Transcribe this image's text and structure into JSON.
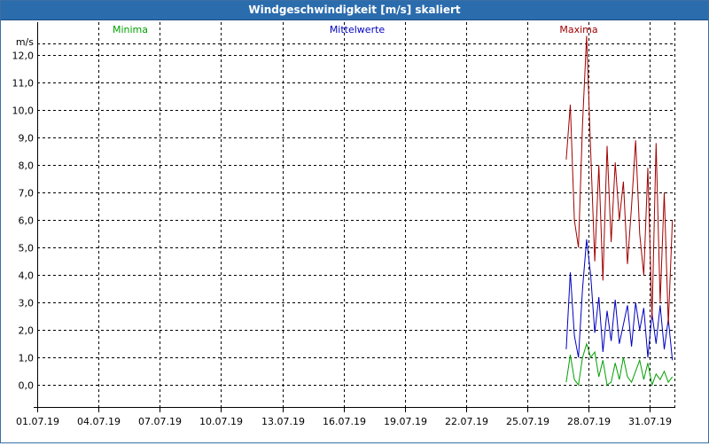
{
  "window": {
    "title": "Windgeschwindigkeit [m/s] skaliert"
  },
  "colors": {
    "minima": "#00a000",
    "mittelwerte": "#0000c0",
    "maxima": "#a00000"
  },
  "chart_data": {
    "type": "line",
    "title": "Windgeschwindigkeit [m/s] skaliert",
    "ylabel": "m/s",
    "xlabel": "",
    "ylim": [
      -0.8,
      13.2
    ],
    "yticks": [
      0.0,
      1.0,
      2.0,
      3.0,
      4.0,
      5.0,
      6.0,
      7.0,
      8.0,
      9.0,
      10.0,
      11.0,
      12.0
    ],
    "ytick_labels": [
      "0,0",
      "1,0",
      "2,0",
      "3,0",
      "4,0",
      "5,0",
      "6,0",
      "7,0",
      "8,0",
      "9,0",
      "10,0",
      "11,0",
      "12,0"
    ],
    "xlim": [
      0,
      31.2
    ],
    "xticks": [
      0,
      3,
      6,
      9,
      12,
      15,
      18,
      21,
      24,
      27,
      30
    ],
    "xtick_labels": [
      "01.07.19",
      "04.07.19",
      "07.07.19",
      "10.07.19",
      "13.07.19",
      "16.07.19",
      "19.07.19",
      "22.07.19",
      "25.07.19",
      "28.07.19",
      "31.07.19"
    ],
    "x_unit": "days since 01.07.19",
    "grid": true,
    "series": [
      {
        "name": "Minima",
        "color": "#00a000",
        "x": [
          25.9,
          26.1,
          26.3,
          26.5,
          26.7,
          26.9,
          27.1,
          27.3,
          27.5,
          27.7,
          27.9,
          28.1,
          28.3,
          28.5,
          28.7,
          28.9,
          29.1,
          29.3,
          29.5,
          29.7,
          29.9,
          30.1,
          30.3,
          30.5,
          30.7,
          30.9,
          31.1
        ],
        "values": [
          0.1,
          1.1,
          0.2,
          0.0,
          1.0,
          1.5,
          1.0,
          1.2,
          0.3,
          0.9,
          0.0,
          0.1,
          0.8,
          0.2,
          1.0,
          0.3,
          0.1,
          0.5,
          0.9,
          0.2,
          0.8,
          0.0,
          0.4,
          0.2,
          0.5,
          0.1,
          0.3
        ]
      },
      {
        "name": "Mittelwerte",
        "color": "#0000c0",
        "x": [
          25.9,
          26.1,
          26.3,
          26.5,
          26.7,
          26.9,
          27.1,
          27.3,
          27.5,
          27.7,
          27.9,
          28.1,
          28.3,
          28.5,
          28.7,
          28.9,
          29.1,
          29.3,
          29.5,
          29.7,
          29.9,
          30.1,
          30.3,
          30.5,
          30.7,
          30.9,
          31.1
        ],
        "values": [
          1.3,
          4.1,
          1.8,
          1.0,
          3.5,
          5.3,
          4.0,
          1.9,
          3.2,
          1.2,
          2.7,
          1.6,
          3.1,
          1.5,
          2.2,
          2.9,
          1.4,
          3.0,
          2.0,
          2.8,
          1.0,
          2.6,
          1.5,
          2.9,
          1.3,
          2.4,
          0.9
        ]
      },
      {
        "name": "Maxima",
        "color": "#a00000",
        "x": [
          25.9,
          26.1,
          26.3,
          26.5,
          26.7,
          26.9,
          27.1,
          27.3,
          27.5,
          27.7,
          27.9,
          28.1,
          28.3,
          28.5,
          28.7,
          28.9,
          29.1,
          29.3,
          29.5,
          29.7,
          29.9,
          30.1,
          30.3,
          30.5,
          30.7,
          30.9,
          31.1
        ],
        "values": [
          8.2,
          10.2,
          6.0,
          5.0,
          9.5,
          12.7,
          8.5,
          4.5,
          8.0,
          3.8,
          8.7,
          5.2,
          8.1,
          6.0,
          7.4,
          4.4,
          6.5,
          8.9,
          5.5,
          4.0,
          7.9,
          2.4,
          8.8,
          3.0,
          7.0,
          2.2,
          6.0
        ]
      }
    ]
  }
}
